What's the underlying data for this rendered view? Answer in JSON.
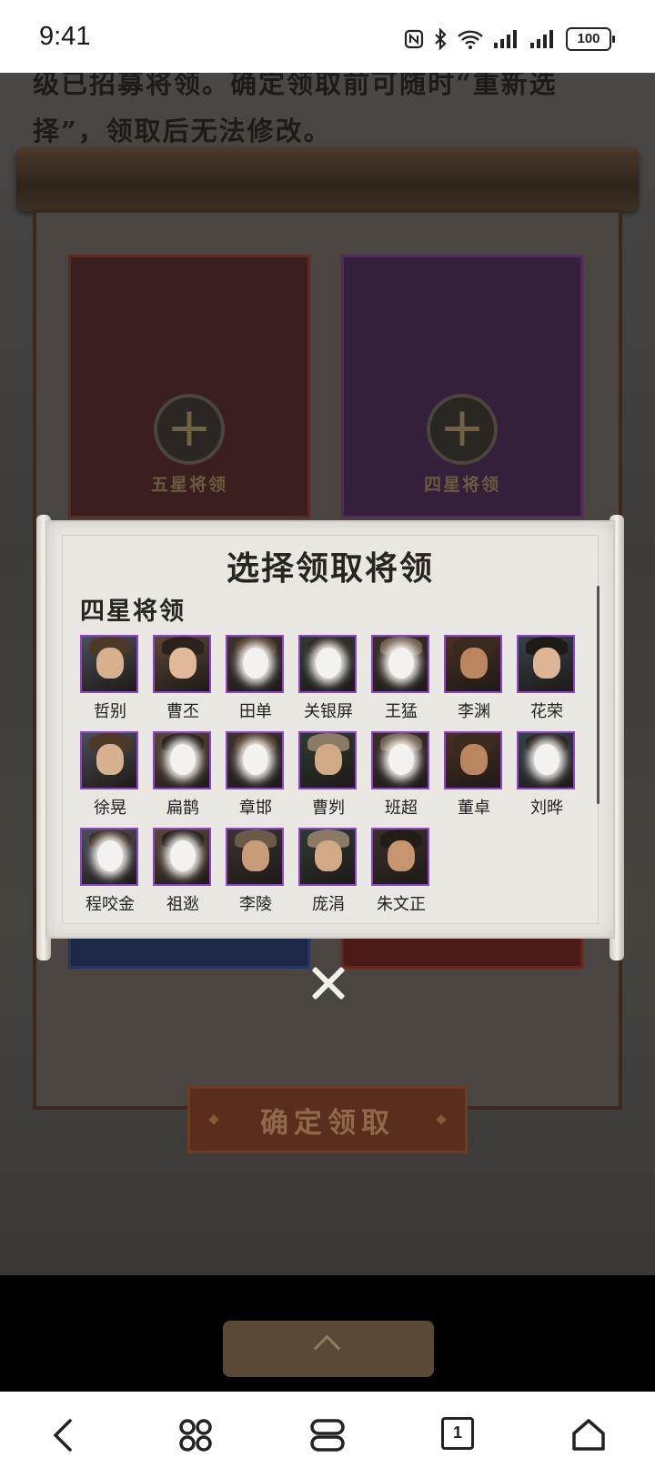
{
  "status_bar": {
    "time": "9:41",
    "battery": "100"
  },
  "intro": {
    "text": "级已招募将领。确定领取前可随时“重新选择”，领取后无法修改。"
  },
  "slots": [
    {
      "label": "五星将领"
    },
    {
      "label": "四星将领"
    }
  ],
  "confirm_button": {
    "label": "确定领取"
  },
  "modal": {
    "title": "选择领取将领",
    "section_title": "四星将领",
    "heroes": [
      {
        "name": "哲别"
      },
      {
        "name": "曹丕"
      },
      {
        "name": "田单"
      },
      {
        "name": "关银屏"
      },
      {
        "name": "王猛"
      },
      {
        "name": "李渊"
      },
      {
        "name": "花荣"
      },
      {
        "name": "徐晃"
      },
      {
        "name": "扁鹊"
      },
      {
        "name": "章邯"
      },
      {
        "name": "曹刿"
      },
      {
        "name": "班超"
      },
      {
        "name": "董卓"
      },
      {
        "name": "刘晔"
      },
      {
        "name": "程咬金"
      },
      {
        "name": "祖逖"
      },
      {
        "name": "李陵"
      },
      {
        "name": "庞涓"
      },
      {
        "name": "朱文正"
      }
    ]
  },
  "colors": {
    "portrait_border": "#8c45c8",
    "modal_bg": "#e9e7e1"
  },
  "nav": {
    "tab_count": "1"
  }
}
